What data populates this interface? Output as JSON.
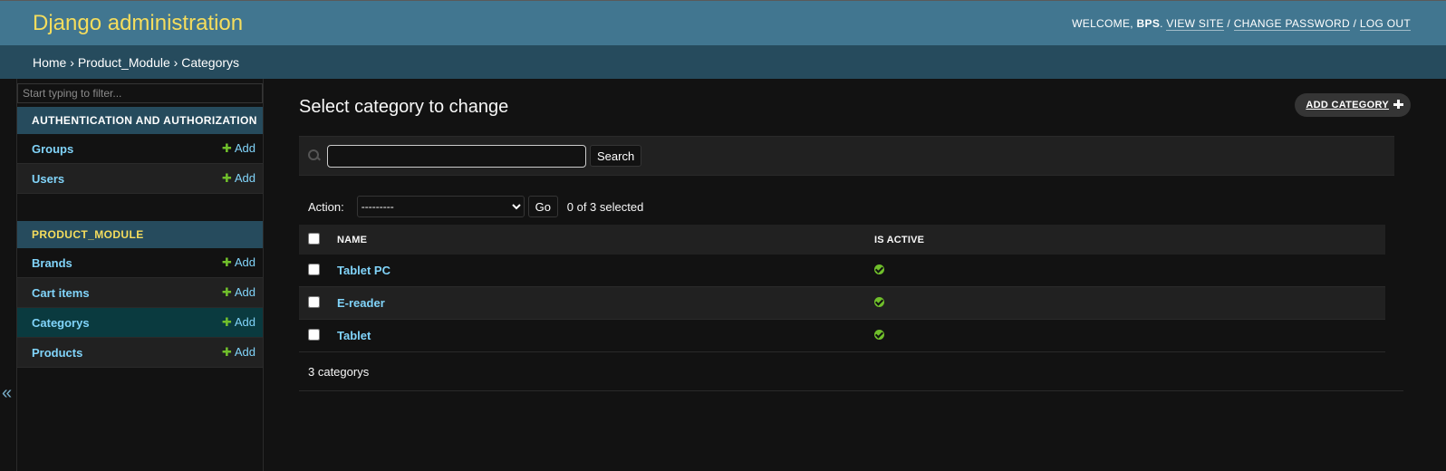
{
  "header": {
    "title": "Django administration",
    "welcome": "WELCOME,",
    "username": "BPS",
    "links": [
      "VIEW SITE",
      "CHANGE PASSWORD",
      "LOG OUT"
    ]
  },
  "breadcrumbs": [
    "Home",
    "Product_Module",
    "Categorys"
  ],
  "sidebar": {
    "filter_placeholder": "Start typing to filter...",
    "collapse_glyph": "«",
    "add_label": "Add",
    "apps": [
      {
        "name": "AUTHENTICATION AND AUTHORIZATION",
        "models": [
          "Groups",
          "Users"
        ]
      },
      {
        "name": "PRODUCT_MODULE",
        "models": [
          "Brands",
          "Cart items",
          "Categorys",
          "Products"
        ]
      }
    ],
    "current_model": "Categorys"
  },
  "content": {
    "title": "Select category to change",
    "add_button": "ADD CATEGORY",
    "search_button": "Search",
    "search_value": "",
    "action_label": "Action:",
    "action_selected": "---------",
    "go_button": "Go",
    "selection_counter": "0 of 3 selected",
    "columns": [
      "NAME",
      "IS ACTIVE"
    ],
    "rows": [
      {
        "name": "Tablet PC",
        "is_active": true
      },
      {
        "name": "E-reader",
        "is_active": true
      },
      {
        "name": "Tablet",
        "is_active": true
      }
    ],
    "paginator": "3 categorys"
  },
  "colors": {
    "header_bg": "#417690",
    "breadcrumb_bg": "#264b5d",
    "brand": "#f5dd5d",
    "link": "#81d4fa",
    "success": "#70bf2b",
    "page_bg": "#121212"
  },
  "icons": {
    "search": "search-icon",
    "add": "plus-icon",
    "active": "check-circle-icon",
    "collapse": "chevron-double-left-icon"
  }
}
